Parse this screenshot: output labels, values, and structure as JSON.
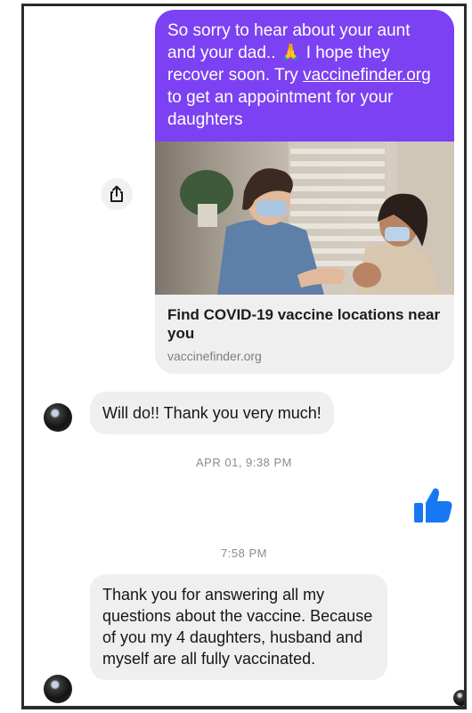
{
  "thread": {
    "sent_message": {
      "text_before_link": "So sorry to hear about your aunt and your dad.. 🙏 I hope they recover soon.  Try ",
      "link_text": "vaccinefinder.org",
      "text_after_link": " to get an appointment for your daughters"
    },
    "link_preview": {
      "title": "Find COVID-19 vaccine locations near you",
      "domain": "vaccinefinder.org",
      "image_icon": "vaccination-photo"
    },
    "share_icon": "share-icon",
    "reply_1": "Will do!! Thank you very much!",
    "timestamp_1": "APR 01, 9:38 PM",
    "reaction_icon": "thumbs-up-icon",
    "timestamp_2": "7:58 PM",
    "reply_2": "Thank you for answering all my questions about the vaccine. Because of you my 4 daughters, husband and myself are all fully vaccinated.",
    "accent_color": "#7c41f2",
    "like_color": "#1877f2"
  }
}
